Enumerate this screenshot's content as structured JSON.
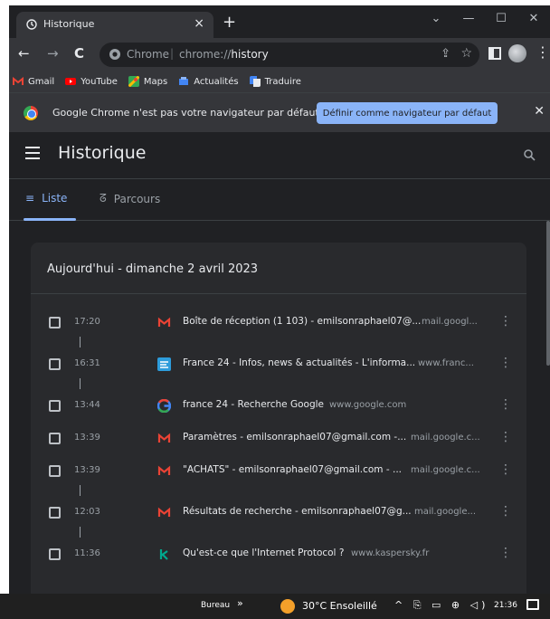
{
  "tab": {
    "title": "Historique",
    "close": "×",
    "new_tab": "+"
  },
  "window_controls": {
    "tabsearch": "⌄",
    "minimize": "—",
    "maximize": "☐",
    "close": "✕"
  },
  "toolbar": {
    "back": "←",
    "forward": "→",
    "reload": "C",
    "omnibox_site": "Chrome",
    "omnibox_sep": "|",
    "omnibox_url_prefix": "chrome://",
    "omnibox_url_path": "history",
    "share": "⇪",
    "star": "☆",
    "menu": "⋮"
  },
  "bookmarks": [
    {
      "label": "Gmail",
      "icon": "gmail-icon",
      "color": "#ea4335"
    },
    {
      "label": "YouTube",
      "icon": "youtube-icon",
      "color": "#ff0000"
    },
    {
      "label": "Maps",
      "icon": "maps-icon",
      "color": "#34a853"
    },
    {
      "label": "Actualités",
      "icon": "news-icon",
      "color": "#4285f4"
    },
    {
      "label": "Traduire",
      "icon": "translate-icon",
      "color": "#4285f4"
    }
  ],
  "infobar": {
    "text": "Google Chrome n'est pas votre navigateur par défaut",
    "button": "Définir comme navigateur par défaut",
    "close": "✕"
  },
  "page": {
    "title": "Historique",
    "tabs": [
      {
        "label": "Liste",
        "icon": "list-icon",
        "active": true
      },
      {
        "label": "Parcours",
        "icon": "journeys-icon",
        "active": false
      }
    ],
    "date_heading": "Aujourd'hui - dimanche 2 avril 2023"
  },
  "history": [
    {
      "time": "17:20",
      "title": "Boîte de réception (1 103) - emilsonraphael07@...",
      "domain": "mail.googl...",
      "favicon": "gmail-icon"
    },
    {
      "time": "16:31",
      "title": "France 24 - Infos, news & actualités - L'informa...",
      "domain": "www.franc...",
      "favicon": "france24-icon"
    },
    {
      "time": "13:44",
      "title": "france 24 - Recherche Google",
      "domain": "www.google.com",
      "favicon": "google-icon"
    },
    {
      "time": "13:39",
      "title": "Paramètres - emilsonraphael07@gmail.com -...",
      "domain": "mail.google.c...",
      "favicon": "gmail-icon"
    },
    {
      "time": "13:39",
      "title": "\"ACHATS\" - emilsonraphael07@gmail.com - ...",
      "domain": "mail.google.c...",
      "favicon": "gmail-icon"
    },
    {
      "time": "12:03",
      "title": "Résultats de recherche - emilsonraphael07@g...",
      "domain": "mail.google...",
      "favicon": "gmail-icon"
    },
    {
      "time": "11:36",
      "title": "Qu'est-ce que l'Internet Protocol ?",
      "domain": "www.kaspersky.fr",
      "favicon": "kaspersky-icon"
    }
  ],
  "row_more": "⋮",
  "taskbar": {
    "bureau": "Bureau",
    "chevron": "»",
    "weather": "30°C  Ensoleillé",
    "tray": "^ ⎘ ▭ ⊕ ◁)",
    "clock": "21:36"
  },
  "colors": {
    "accent": "#8ab4f8",
    "background": "#202124",
    "card": "#292a2d"
  }
}
